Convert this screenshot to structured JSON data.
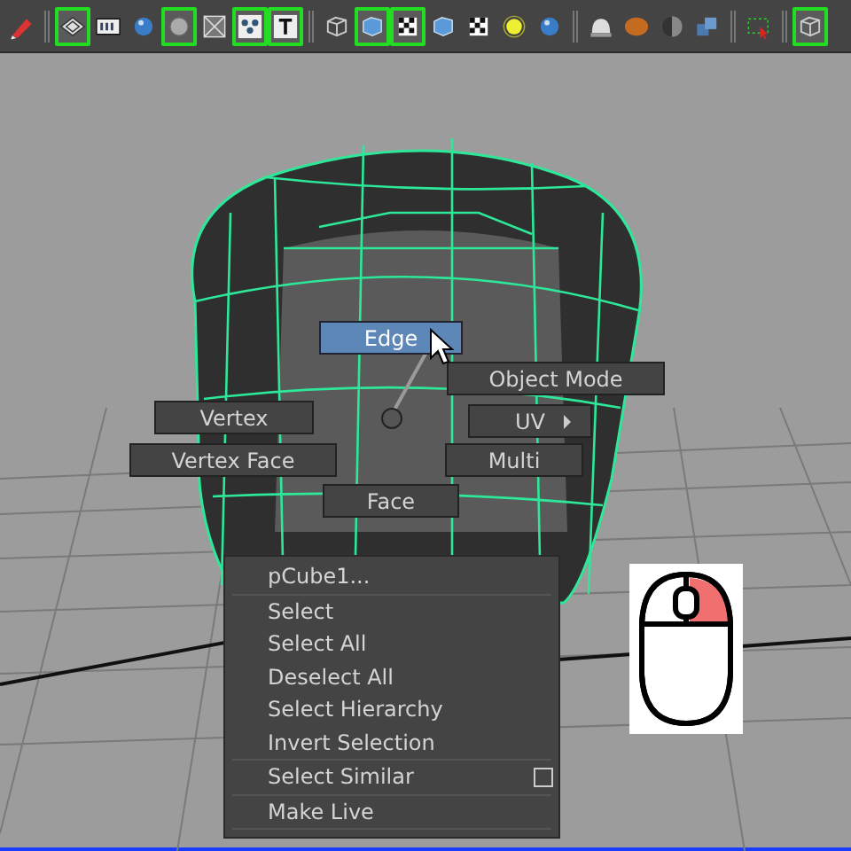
{
  "toolbar": {
    "buttons": [
      {
        "kind": "pencil",
        "on": false
      },
      {
        "kind": "grid",
        "on": true
      },
      {
        "kind": "film",
        "on": false
      },
      {
        "kind": "sphere",
        "on": false
      },
      {
        "kind": "circle",
        "on": true
      },
      {
        "kind": "mesh",
        "on": false
      },
      {
        "kind": "dots",
        "on": true
      },
      {
        "kind": "text",
        "on": true
      },
      {
        "kind": "wirecube",
        "on": false
      },
      {
        "kind": "cube",
        "on": true
      },
      {
        "kind": "check",
        "on": true
      },
      {
        "kind": "cube",
        "on": false
      },
      {
        "kind": "check",
        "on": false
      },
      {
        "kind": "light",
        "on": false
      },
      {
        "kind": "sphere",
        "on": false
      },
      {
        "kind": "dome",
        "on": false
      },
      {
        "kind": "orange",
        "on": false
      },
      {
        "kind": "half",
        "on": false
      },
      {
        "kind": "cubes",
        "on": false
      },
      {
        "kind": "marquee",
        "on": false
      },
      {
        "kind": "wirecube",
        "on": true
      }
    ]
  },
  "marking_menu": {
    "items": [
      {
        "label": "Edge",
        "selected": true,
        "submenu": false
      },
      {
        "label": "Object Mode",
        "selected": false,
        "submenu": false
      },
      {
        "label": "Vertex",
        "selected": false,
        "submenu": false
      },
      {
        "label": "UV",
        "selected": false,
        "submenu": true
      },
      {
        "label": "Vertex Face",
        "selected": false,
        "submenu": false
      },
      {
        "label": "Multi",
        "selected": false,
        "submenu": false
      },
      {
        "label": "Face",
        "selected": false,
        "submenu": false
      }
    ]
  },
  "context_menu": {
    "groups": [
      [
        {
          "label": "pCube1...",
          "option_box": false
        }
      ],
      [
        {
          "label": "Select",
          "option_box": false
        },
        {
          "label": "Select All",
          "option_box": false
        },
        {
          "label": "Deselect All",
          "option_box": false
        },
        {
          "label": "Select Hierarchy",
          "option_box": false
        },
        {
          "label": "Invert Selection",
          "option_box": false
        }
      ],
      [
        {
          "label": "Select Similar",
          "option_box": true
        }
      ],
      [
        {
          "label": "Make Live",
          "option_box": false
        }
      ]
    ]
  }
}
